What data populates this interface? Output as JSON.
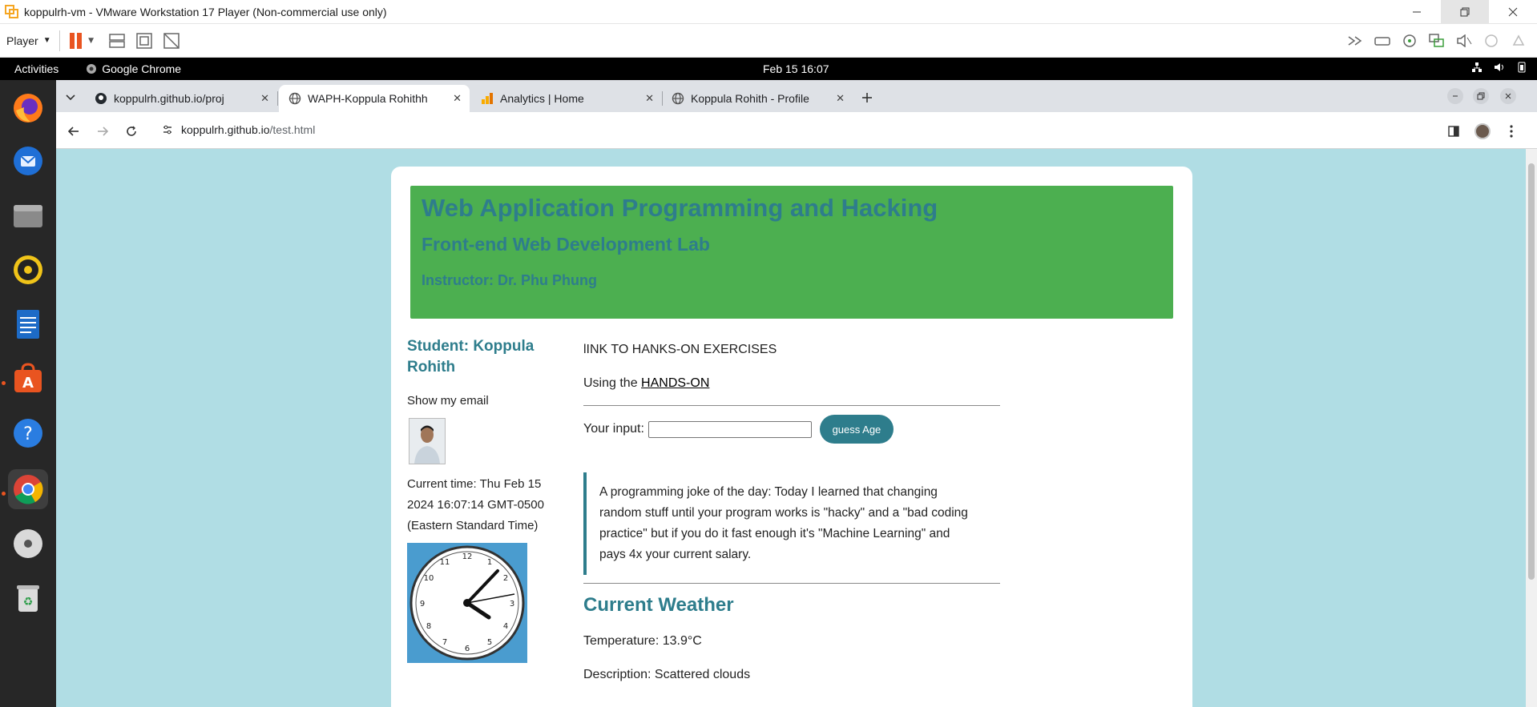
{
  "vm": {
    "title": "koppulrh-vm - VMware Workstation 17 Player (Non-commercial use only)",
    "player_menu": "Player"
  },
  "gnome": {
    "activities": "Activities",
    "app": "Google Chrome",
    "clock": "Feb 15  16:07"
  },
  "browser": {
    "tabs": [
      {
        "title": "koppulrh.github.io/proj",
        "favicon": "github-icon"
      },
      {
        "title": "WAPH-Koppula Rohithh",
        "favicon": "globe-icon"
      },
      {
        "title": "Analytics | Home",
        "favicon": "analytics-icon"
      },
      {
        "title": "Koppula Rohith - Profile",
        "favicon": "globe-icon"
      }
    ],
    "url_host": "koppulrh.github.io",
    "url_path": "/test.html"
  },
  "page": {
    "header": {
      "title": "Web Application Programming and Hacking",
      "subtitle": "Front-end Web Development Lab",
      "instructor": "Instructor: Dr. Phu Phung"
    },
    "student": "Student: Koppula Rohith",
    "show_email": "Show my email",
    "current_time": "Current time: Thu Feb 15 2024 16:07:14 GMT-0500 (Eastern Standard Time)",
    "link_to": "lINK TO HANKS-ON EXERCISES",
    "using_prefix": "Using the ",
    "using_link": "HANDS-ON",
    "input_label": "Your input:",
    "input_value": "",
    "guess_button": "guess Age",
    "joke": "A programming joke of the day: Today I learned that changing random stuff until your program works is \"hacky\" and a \"bad coding practice\" but if you do it fast enough it's \"Machine Learning\" and pays 4x your current salary.",
    "weather_title": "Current Weather",
    "temperature": "Temperature: 13.9°C",
    "description": "Description: Scattered clouds"
  },
  "dock_apps": [
    "firefox-icon",
    "thunderbird-icon",
    "files-icon",
    "rhythmbox-icon",
    "writer-icon",
    "software-icon",
    "help-icon",
    "chrome-icon",
    "dvd-icon",
    "trash-icon"
  ]
}
